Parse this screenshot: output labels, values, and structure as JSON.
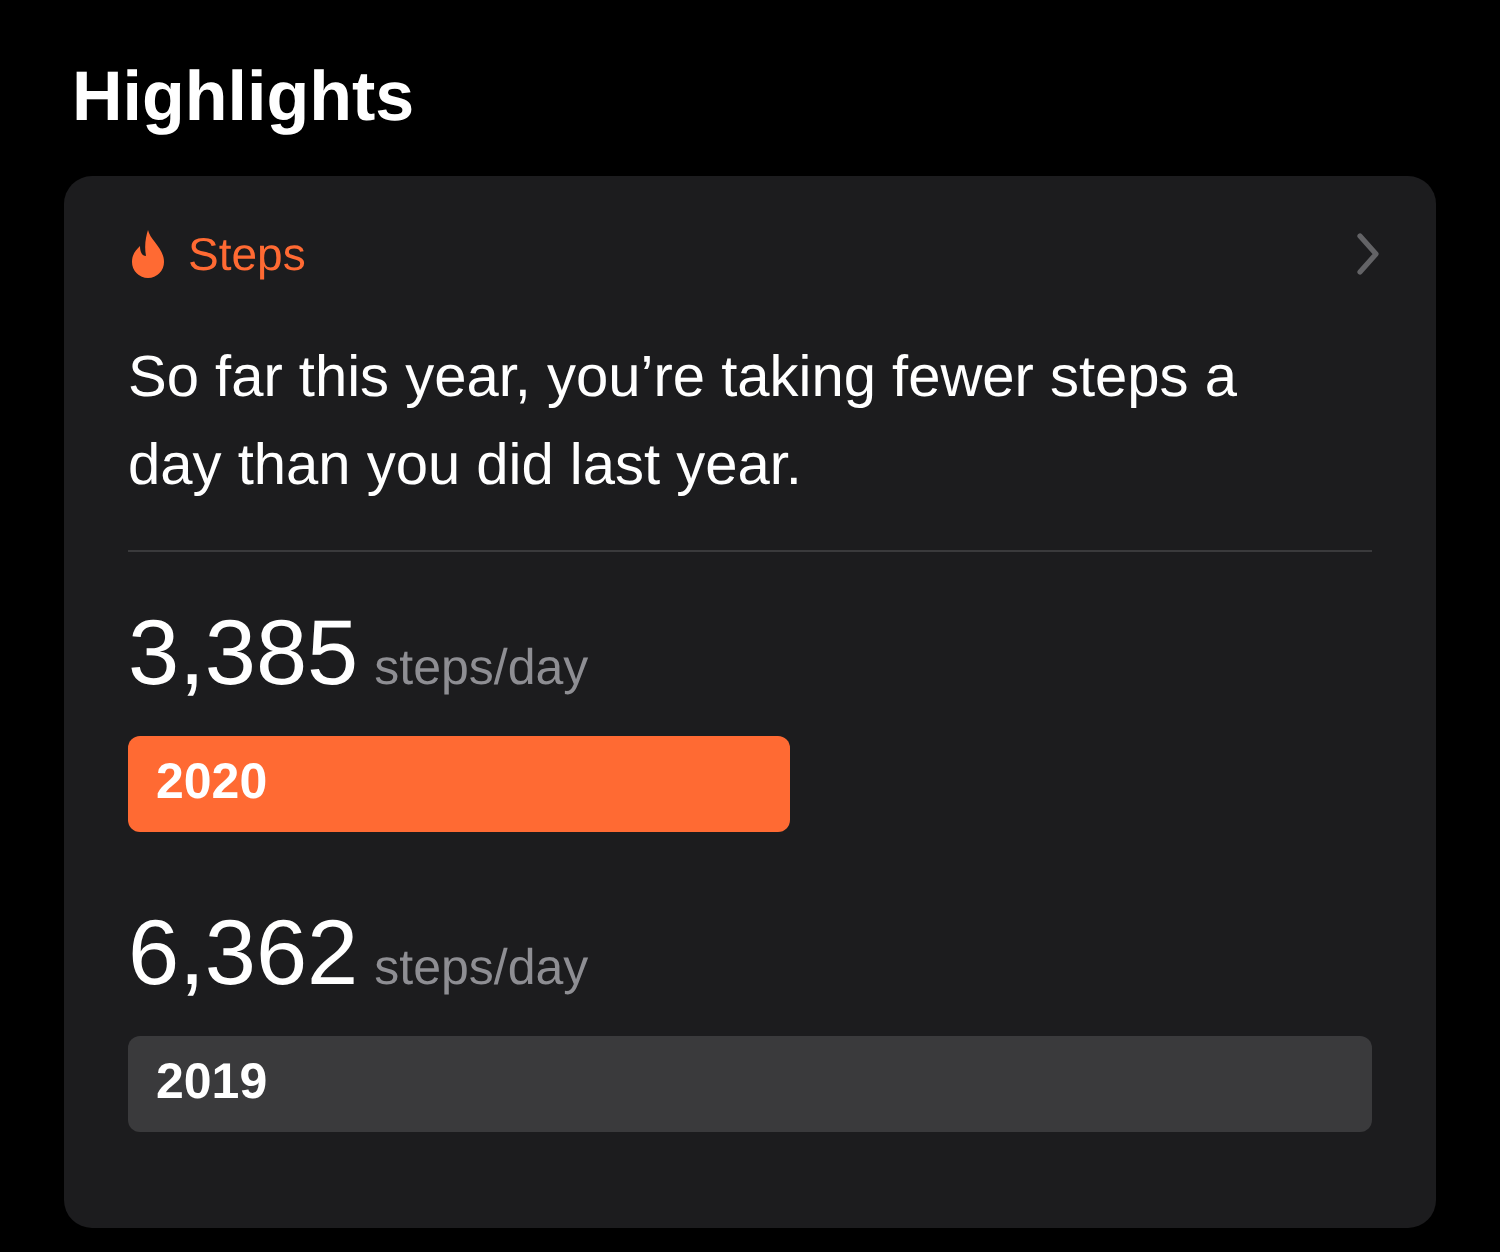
{
  "title": "Highlights",
  "highlight": {
    "category": "Steps",
    "summary": "So far this year, you’re taking fewer steps a day than you did last year.",
    "comparisons": [
      {
        "value": "3,385",
        "unit": "steps/day",
        "year": "2020",
        "color": "#ff6a33"
      },
      {
        "value": "6,362",
        "unit": "steps/day",
        "year": "2019",
        "color": "#3a3a3c"
      }
    ]
  }
}
